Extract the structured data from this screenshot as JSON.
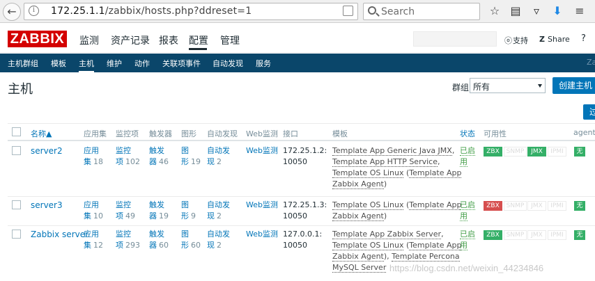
{
  "browser": {
    "url_host": "172.25.1.1",
    "url_path": "/zabbix/hosts.php?ddreset=1",
    "search_placeholder": "Search"
  },
  "header": {
    "logo": "ZABBIX",
    "menu": [
      "监测",
      "资产记录",
      "报表",
      "配置",
      "管理"
    ],
    "active_menu": "配置",
    "support_label": "支持",
    "share_label": "Share",
    "help_label": "?"
  },
  "subnav": {
    "items": [
      "主机群组",
      "模板",
      "主机",
      "维护",
      "动作",
      "关联项事件",
      "自动发现",
      "服务"
    ],
    "active": "主机",
    "right_text": "Za"
  },
  "page": {
    "title": "主机",
    "group_label": "群组",
    "group_value": "所有",
    "create_button": "创建主机",
    "filter_button": "过"
  },
  "table": {
    "headers": [
      "名称▲",
      "应用集",
      "监控项",
      "触发器",
      "图形",
      "自动发现",
      "Web监测",
      "接口",
      "模板",
      "状态",
      "可用性",
      "agent"
    ],
    "rows": [
      {
        "name": "server2",
        "apps_l1": "应用",
        "apps_l2": "集",
        "apps_count": "18",
        "items_l1": "监控",
        "items_l2": "项",
        "items_count": "102",
        "triggers_l1": "触发",
        "triggers_l2": "器",
        "triggers_count": "46",
        "graphs_l1": "图",
        "graphs_l2": "形",
        "graphs_count": "19",
        "disc_l1": "自动发",
        "disc_l2": "现",
        "disc_count": "2",
        "web": "Web监测",
        "iface_l1": "172.25.1.2:",
        "iface_l2": "10050",
        "tpl_lines": [
          [
            {
              "t": "Template App Generic Java JMX",
              "u": true
            },
            {
              "t": ","
            }
          ],
          [
            {
              "t": "Template App HTTP Service",
              "u": true
            },
            {
              "t": ","
            }
          ],
          [
            {
              "t": "Template OS Linux",
              "u": true
            },
            {
              "t": " ("
            },
            {
              "t": "Template App",
              "u": true
            }
          ],
          [
            {
              "t": "Zabbix Agent",
              "u": true
            },
            {
              "t": ")"
            }
          ]
        ],
        "status_l1": "已启",
        "status_l2": "用",
        "avail": [
          {
            "label": "ZBX",
            "state": "green"
          },
          {
            "label": "SNMP",
            "state": "grey"
          },
          {
            "label": "JMX",
            "state": "green"
          },
          {
            "label": "IPMI",
            "state": "grey"
          }
        ],
        "agent": "无"
      },
      {
        "name": "server3",
        "apps_l1": "应用",
        "apps_l2": "集",
        "apps_count": "10",
        "items_l1": "监控",
        "items_l2": "项",
        "items_count": "49",
        "triggers_l1": "触发",
        "triggers_l2": "器",
        "triggers_count": "19",
        "graphs_l1": "图",
        "graphs_l2": "形",
        "graphs_count": "9",
        "disc_l1": "自动发",
        "disc_l2": "现",
        "disc_count": "2",
        "web": "Web监测",
        "iface_l1": "172.25.1.3:",
        "iface_l2": "10050",
        "tpl_lines": [
          [
            {
              "t": "Template OS Linux",
              "u": true
            },
            {
              "t": " ("
            },
            {
              "t": "Template App",
              "u": true
            }
          ],
          [
            {
              "t": "Zabbix Agent",
              "u": true
            },
            {
              "t": ")"
            }
          ]
        ],
        "status_l1": "已启",
        "status_l2": "用",
        "avail": [
          {
            "label": "ZBX",
            "state": "red"
          },
          {
            "label": "SNMP",
            "state": "grey"
          },
          {
            "label": "JMX",
            "state": "grey"
          },
          {
            "label": "IPMI",
            "state": "grey"
          }
        ],
        "agent": "无"
      },
      {
        "name": "Zabbix server",
        "apps_l1": "应用",
        "apps_l2": "集",
        "apps_count": "12",
        "items_l1": "监控",
        "items_l2": "项",
        "items_count": "293",
        "triggers_l1": "触发",
        "triggers_l2": "器",
        "triggers_count": "60",
        "graphs_l1": "图",
        "graphs_l2": "形",
        "graphs_count": "60",
        "disc_l1": "自动发",
        "disc_l2": "现",
        "disc_count": "2",
        "web": "Web监测",
        "iface_l1": "127.0.0.1:",
        "iface_l2": "10050",
        "tpl_lines": [
          [
            {
              "t": "Template App Zabbix Server",
              "u": true
            },
            {
              "t": ","
            }
          ],
          [
            {
              "t": "Template OS Linux",
              "u": true
            },
            {
              "t": " ("
            },
            {
              "t": "Template App",
              "u": true
            }
          ],
          [
            {
              "t": "Zabbix Agent",
              "u": true
            },
            {
              "t": "), "
            },
            {
              "t": "Template Percona",
              "u": true
            }
          ],
          [
            {
              "t": "MySQL Server",
              "u": true
            }
          ]
        ],
        "status_l1": "已启",
        "status_l2": "用",
        "avail": [
          {
            "label": "ZBX",
            "state": "green"
          },
          {
            "label": "SNMP",
            "state": "grey"
          },
          {
            "label": "JMX",
            "state": "grey"
          },
          {
            "label": "IPMI",
            "state": "grey"
          }
        ],
        "agent": "无"
      }
    ]
  },
  "watermark": "https://blog.csdn.net/weixin_44234846"
}
